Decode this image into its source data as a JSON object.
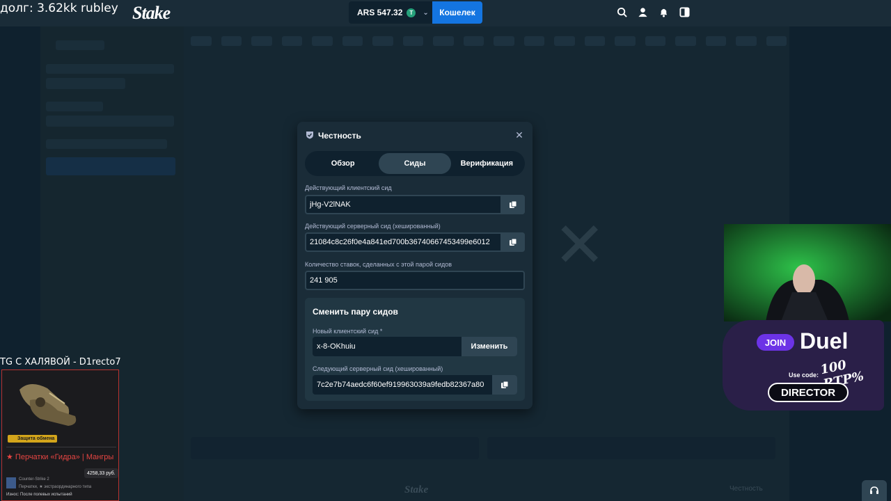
{
  "overlay": {
    "debt_text": "долг: 3.62kk rubley",
    "tg_text": "TG С ХАЛЯВОЙ - D1recto7"
  },
  "topbar": {
    "logo": "Stake",
    "balance": "ARS 547.32",
    "currency_icon": "tether-coin-icon",
    "wallet_button": "Кошелек",
    "icons": [
      "search-icon",
      "user-icon",
      "bell-icon",
      "sidebar-toggle-icon"
    ]
  },
  "modal": {
    "title": "Честность",
    "tabs": [
      {
        "label": "Обзор",
        "active": false
      },
      {
        "label": "Сиды",
        "active": true
      },
      {
        "label": "Верификация",
        "active": false
      }
    ],
    "client_seed_label": "Действующий клиентский сид",
    "client_seed_value": "jHg-V2lNAK",
    "server_seed_label": "Действующий серверный сид (хешированный)",
    "server_seed_value": "21084c8c26f0e4a841ed700b36740667453499e6012",
    "bets_label": "Количество ставок, сделанных с этой парой сидов",
    "bets_value": "241 905",
    "change_pair": {
      "title": "Сменить пару сидов",
      "new_client_seed_label": "Новый клиентский сид *",
      "new_client_seed_value": "x-8-OKhuiu",
      "change_button": "Изменить",
      "next_server_seed_label": "Следующий серверный сид (хешированный)",
      "next_server_seed_value": "7c2e7b74aedc6f60ef919963039a9fedb82367a80"
    }
  },
  "skin_card": {
    "badge": "Защита обмена",
    "name": "★ Перчатки «Гидра» | Мангры",
    "price": "4258,33 руб.",
    "game": "Counter-Strike 2",
    "type": "Перчатки, ★ экстраординарного типа",
    "wear": "Износ: После полевых испытаний"
  },
  "duel_ad": {
    "join": "JOIN",
    "brand": "Duel",
    "rtp": "100 RTP%",
    "use_code": "Use code:",
    "code": "DIRECTOR"
  },
  "footer": {
    "logo": "Stake",
    "fairness": "Честность",
    "support_icon": "headset-icon"
  },
  "colors": {
    "background": "#0f212e",
    "panel": "#1a2c38",
    "accent_blue": "#1475e1",
    "input_border": "#2f4553",
    "secondary_text": "#b1bad3"
  }
}
